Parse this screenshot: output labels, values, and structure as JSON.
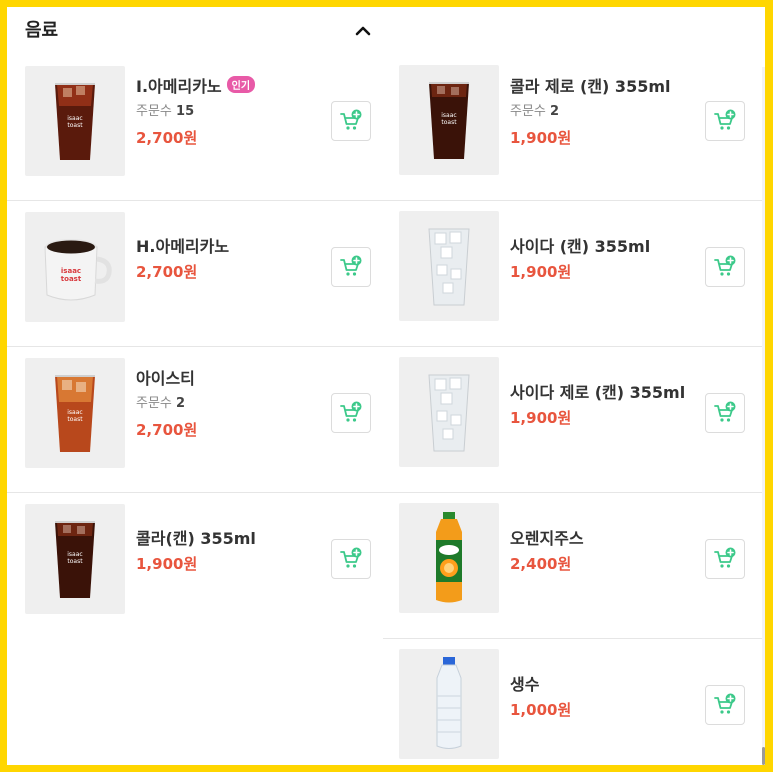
{
  "section": {
    "title": "음료"
  },
  "left_items": [
    {
      "name": "I.아메리카노",
      "badge": "인기",
      "order_label": "주문수",
      "order_count": "15",
      "price": "2,700원",
      "image": "iced-americano-cup-icon"
    },
    {
      "name": "H.아메리카노",
      "price": "2,700원",
      "image": "hot-americano-mug-icon"
    },
    {
      "name": "아이스티",
      "order_label": "주문수",
      "order_count": "2",
      "price": "2,700원",
      "image": "iced-tea-cup-icon"
    },
    {
      "name": "콜라(캔) 355ml",
      "price": "1,900원",
      "image": "cola-cup-icon"
    }
  ],
  "right_items": [
    {
      "name": "콜라 제로 (캔) 355ml",
      "order_label": "주문수",
      "order_count": "2",
      "price": "1,900원",
      "image": "cola-cup-icon"
    },
    {
      "name": "사이다 (캔) 355ml",
      "price": "1,900원",
      "image": "soda-cup-icon"
    },
    {
      "name": "사이다 제로 (캔) 355ml",
      "price": "1,900원",
      "image": "soda-cup-icon"
    },
    {
      "name": "오렌지주스",
      "price": "2,400원",
      "image": "orange-juice-bottle-icon"
    },
    {
      "name": "생수",
      "price": "1,000원",
      "image": "water-bottle-icon"
    }
  ],
  "colors": {
    "price": "#e8553e",
    "badge": "#e85aa7",
    "cart": "#3cc98a",
    "frame": "#ffd600"
  }
}
